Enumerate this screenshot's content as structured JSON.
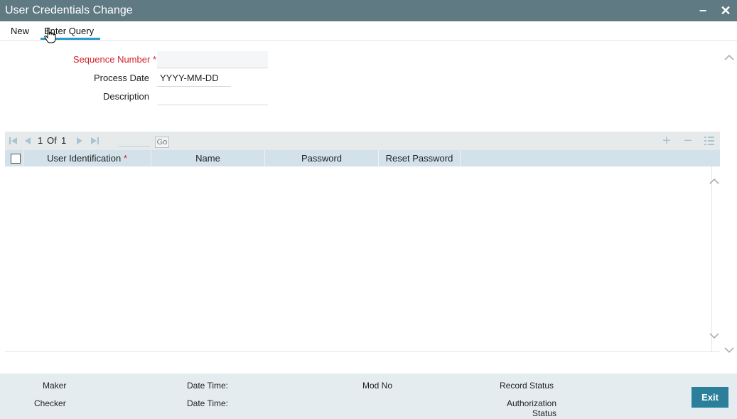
{
  "window": {
    "title": "User Credentials Change",
    "minimize_label": "−",
    "close_label": "✕"
  },
  "menu": {
    "new_label": "New",
    "enter_query_label": "Enter Query"
  },
  "form": {
    "sequence_number": {
      "label": "Sequence Number",
      "required_mark": "*",
      "value": ""
    },
    "process_date": {
      "label": "Process Date",
      "value": "YYYY-MM-DD"
    },
    "description": {
      "label": "Description",
      "value": ""
    }
  },
  "grid": {
    "pager": {
      "current": "1",
      "of_label": "Of",
      "total": "1",
      "go_label": "Go"
    },
    "columns": [
      "User Identification",
      "Name",
      "Password",
      "Reset Password"
    ],
    "required_mark": "*",
    "add_icon": "plus-icon",
    "remove_icon": "minus-icon",
    "details_icon": "list-details-icon",
    "rows": []
  },
  "footer": {
    "maker_label": "Maker",
    "checker_label": "Checker",
    "date_time_label_1": "Date Time:",
    "date_time_label_2": "Date Time:",
    "mod_no_label": "Mod No",
    "record_status_label": "Record Status",
    "authorization_status_line1": "Authorization",
    "authorization_status_line2": "Status",
    "exit_label": "Exit"
  },
  "colors": {
    "titlebar": "#5f7a83",
    "accent": "#2e9ac9",
    "required": "#d0232d",
    "exit_button": "#2b7f9a",
    "grid_header": "#d3e2ea",
    "footer": "#e4ecef"
  }
}
